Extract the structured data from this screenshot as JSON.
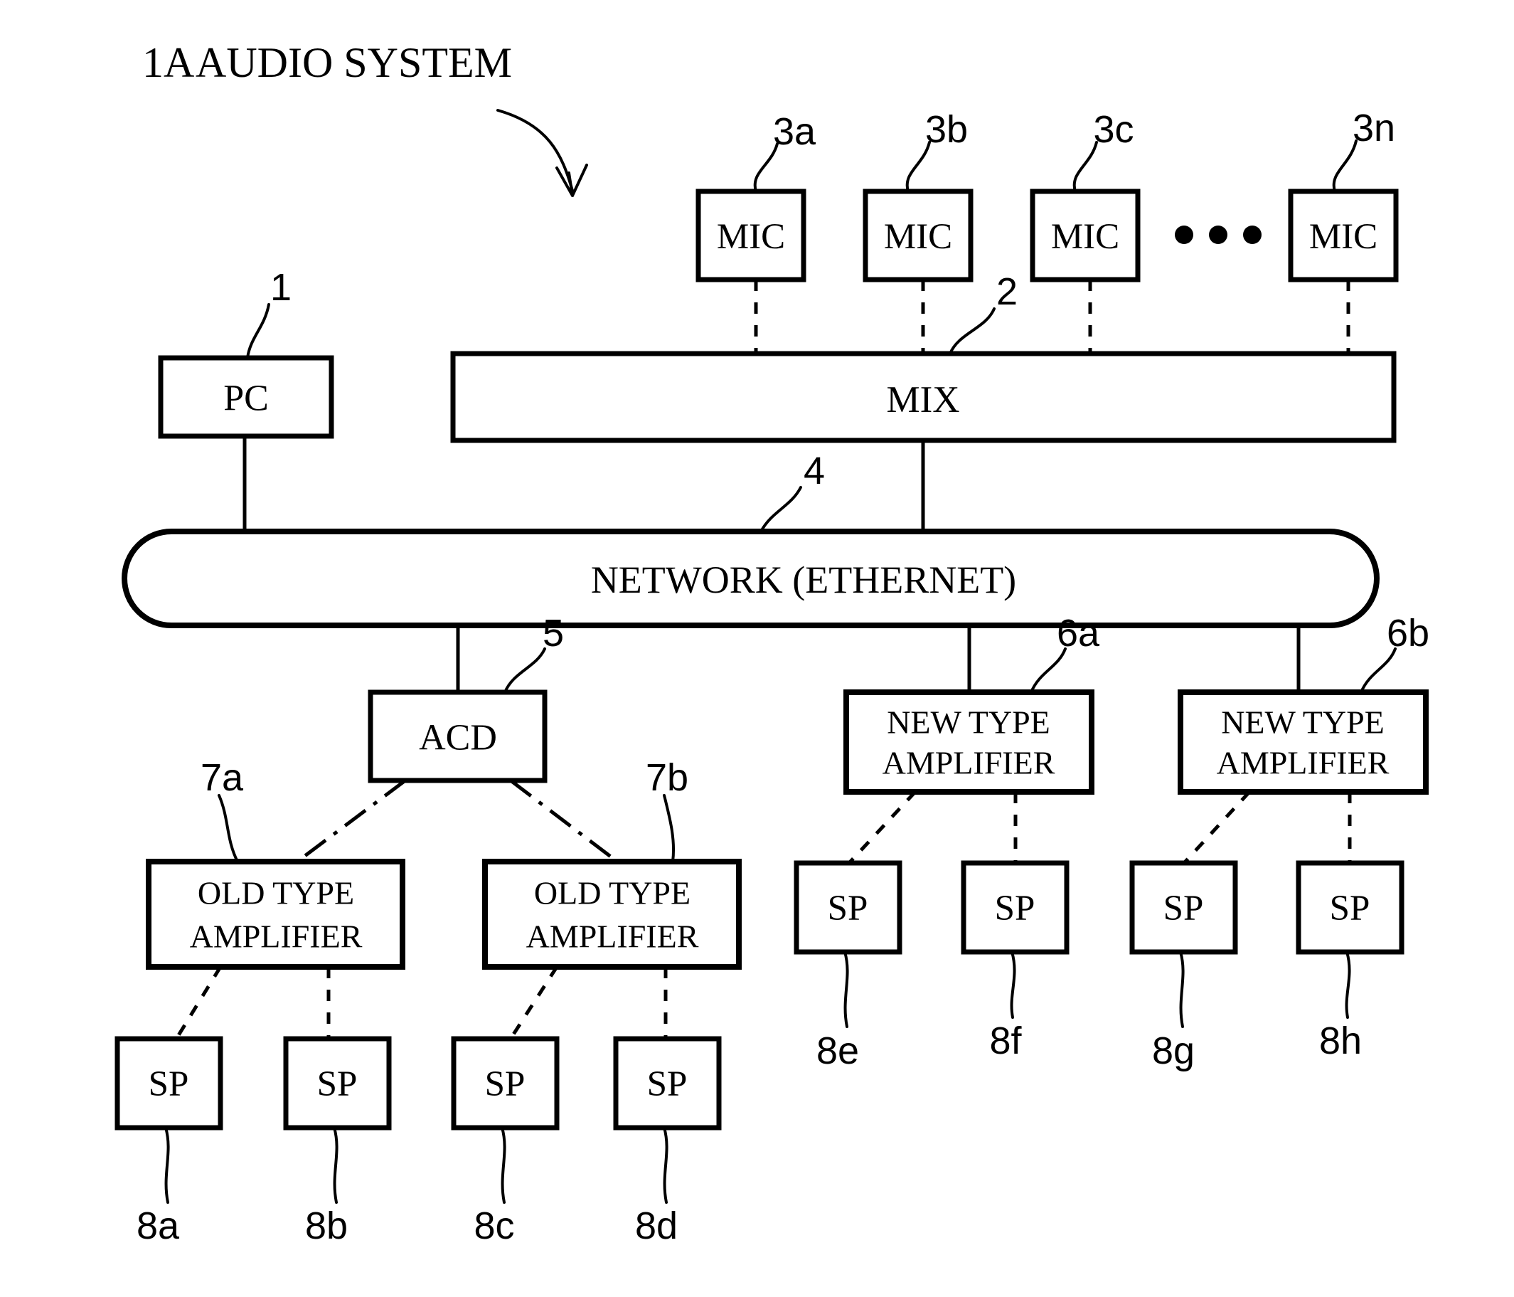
{
  "figure": {
    "title": "1A  AUDIO SYSTEM",
    "title_ref": "1A",
    "title_text": "AUDIO SYSTEM"
  },
  "nodes": {
    "pc": {
      "label": "PC",
      "ref": "1"
    },
    "mix": {
      "label": "MIX",
      "ref": "2"
    },
    "network": {
      "label": "NETWORK (ETHERNET)",
      "ref": "4"
    },
    "acd": {
      "label": "ACD",
      "ref": "5"
    }
  },
  "microphones": [
    {
      "label": "MIC",
      "ref": "3a"
    },
    {
      "label": "MIC",
      "ref": "3b"
    },
    {
      "label": "MIC",
      "ref": "3c"
    },
    {
      "label": "MIC",
      "ref": "3n"
    }
  ],
  "mic_ellipsis": "• • •",
  "old_amplifiers": [
    {
      "line1": "OLD TYPE",
      "line2": "AMPLIFIER",
      "ref": "7a"
    },
    {
      "line1": "OLD TYPE",
      "line2": "AMPLIFIER",
      "ref": "7b"
    }
  ],
  "new_amplifiers": [
    {
      "line1": "NEW TYPE",
      "line2": "AMPLIFIER",
      "ref": "6a"
    },
    {
      "line1": "NEW TYPE",
      "line2": "AMPLIFIER",
      "ref": "6b"
    }
  ],
  "speakers": [
    {
      "label": "SP",
      "ref": "8a"
    },
    {
      "label": "SP",
      "ref": "8b"
    },
    {
      "label": "SP",
      "ref": "8c"
    },
    {
      "label": "SP",
      "ref": "8d"
    },
    {
      "label": "SP",
      "ref": "8e"
    },
    {
      "label": "SP",
      "ref": "8f"
    },
    {
      "label": "SP",
      "ref": "8g"
    },
    {
      "label": "SP",
      "ref": "8h"
    }
  ],
  "colors": {
    "ink": "#000000",
    "paper": "#ffffff"
  }
}
